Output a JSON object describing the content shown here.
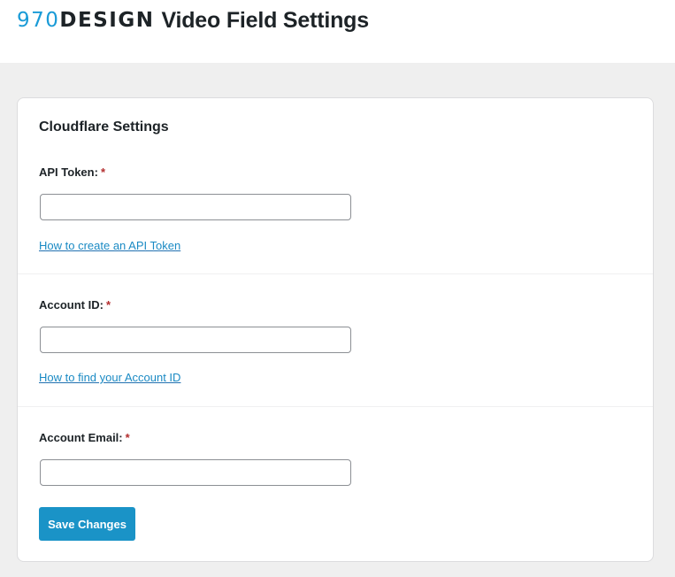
{
  "header": {
    "logo_number": "970",
    "logo_word": "DESIGN",
    "title": "Video Field Settings"
  },
  "colors": {
    "brand_blue": "#1a9bd7",
    "button_blue": "#1a93c7",
    "link_blue": "#2271b1",
    "required_red": "#b32d2e"
  },
  "settings": {
    "section_title": "Cloudflare Settings",
    "required_marker": "*",
    "fields": [
      {
        "label": "API Token:",
        "value": "",
        "help_link": "How to create an API Token"
      },
      {
        "label": "Account ID:",
        "value": "",
        "help_link": "How to find your Account ID"
      },
      {
        "label": "Account Email:",
        "value": ""
      }
    ],
    "save_label": "Save Changes"
  }
}
